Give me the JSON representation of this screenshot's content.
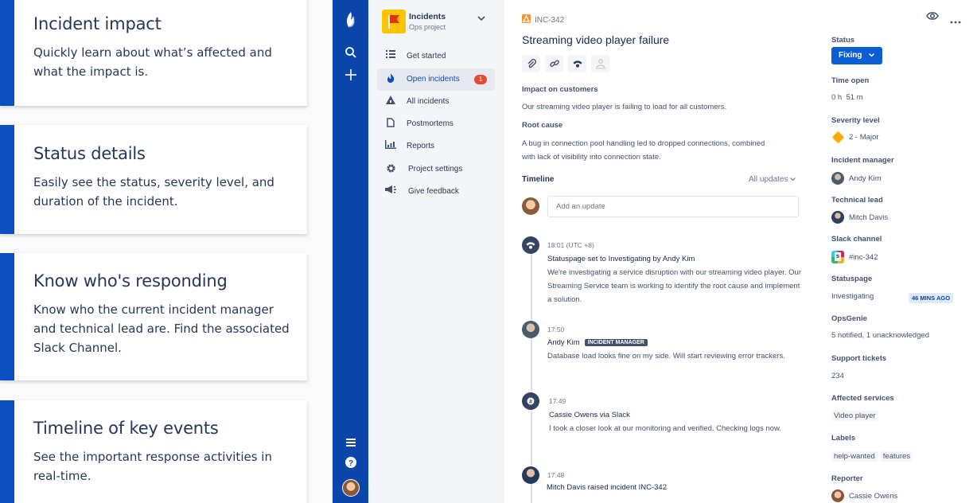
{
  "feature_cards": [
    {
      "title": "Incident impact",
      "description": "Quickly learn about what’s affected and what the impact is."
    },
    {
      "title": "Status details",
      "description": "Easily see the status, severity level, and duration of the incident."
    },
    {
      "title": "Know who's responding",
      "description": "Know who the current incident manager and technical lead are. Find the associated Slack Channel."
    },
    {
      "title": "Timeline of key events",
      "description": "See the important response activities in real-time."
    }
  ],
  "global_nav": {
    "icons": [
      "app-logo-icon",
      "search-icon",
      "create-icon",
      "menu-icon",
      "help-icon",
      "user-avatar"
    ]
  },
  "project": {
    "name": "Incidents",
    "subtitle": "Ops project"
  },
  "sidebar": {
    "items": [
      {
        "label": "Get started",
        "icon": "list-icon"
      },
      {
        "label": "Open incidents",
        "icon": "fire-icon",
        "badge": "1",
        "active": true
      },
      {
        "label": "All incidents",
        "icon": "warning-triangle-icon"
      },
      {
        "label": "Postmortems",
        "icon": "document-icon"
      },
      {
        "label": "Reports",
        "icon": "bar-chart-icon"
      },
      {
        "label": "Project settings",
        "icon": "gear-icon"
      },
      {
        "label": "Give feedback",
        "icon": "megaphone-icon"
      }
    ]
  },
  "issue": {
    "key": "INC-342",
    "title": "Streaming video player failure",
    "toolbar_icons": [
      "attachment-icon",
      "link-icon",
      "statuspage-icon",
      "responder-icon"
    ],
    "impact_heading": "Impact on customers",
    "impact_text": "Our streaming video player is failing to load for all customers.",
    "root_cause_heading": "Root cause",
    "root_cause_text": "A bug in connection pool handling led to dropped connections, combined with lack of visibility into connection state."
  },
  "timeline": {
    "heading": "Timeline",
    "filter": "All updates",
    "input_placeholder": "Add an update",
    "events": [
      {
        "time": "18:01 (UTC +8)",
        "title": "Statuspage set to Investigating by Andy Kim",
        "body": "We're investigating a service disruption with our streaming video player. Our Streaming Service team is working to identify the root cause and implement a solution."
      },
      {
        "time": "17:50",
        "title": "Andy Kim",
        "role": "INCIDENT MANAGER",
        "body": "Database load looks fine on my side. Will start reviewing error trackers."
      },
      {
        "time": "17:49",
        "title": "Cassie Owens via Slack",
        "body": "I took a closer look at our monitoring and verified. Checking logs now."
      },
      {
        "time": "17:48",
        "title": "Mitch Davis raised incident INC-342",
        "body": ""
      }
    ]
  },
  "details": {
    "status_label": "Status",
    "status_value": "Fixing",
    "time_open_label": "Time open",
    "time_open_value": "0 h  51 m",
    "severity_label": "Severity level",
    "severity_value": "2 - Major",
    "incident_manager_label": "Incident manager",
    "incident_manager_value": "Andy Kim",
    "technical_lead_label": "Technical lead",
    "technical_lead_value": "Mitch Davis",
    "slack_label": "Slack channel",
    "slack_value": "#inc-342",
    "statuspage_label": "Statuspage",
    "statuspage_value": "Investigating",
    "statuspage_time": "46 MINS AGO",
    "opsgenie_label": "OpsGenie",
    "opsgenie_value": "5 notified, 1 unacknowledged",
    "support_label": "Support tickets",
    "support_value": "234",
    "affected_label": "Affected services",
    "affected_value": "Video player",
    "labels_label": "Labels",
    "labels": [
      "help-wanted",
      "features"
    ],
    "reporter_label": "Reporter",
    "reporter_value": "Cassie Owens"
  },
  "colors": {
    "brand_blue": "#0b4fc1",
    "nav_blue": "#0b47aa",
    "status_blue": "#0b5cd5",
    "badge_red": "#e5493a",
    "severity_orange": "#ffab00"
  }
}
